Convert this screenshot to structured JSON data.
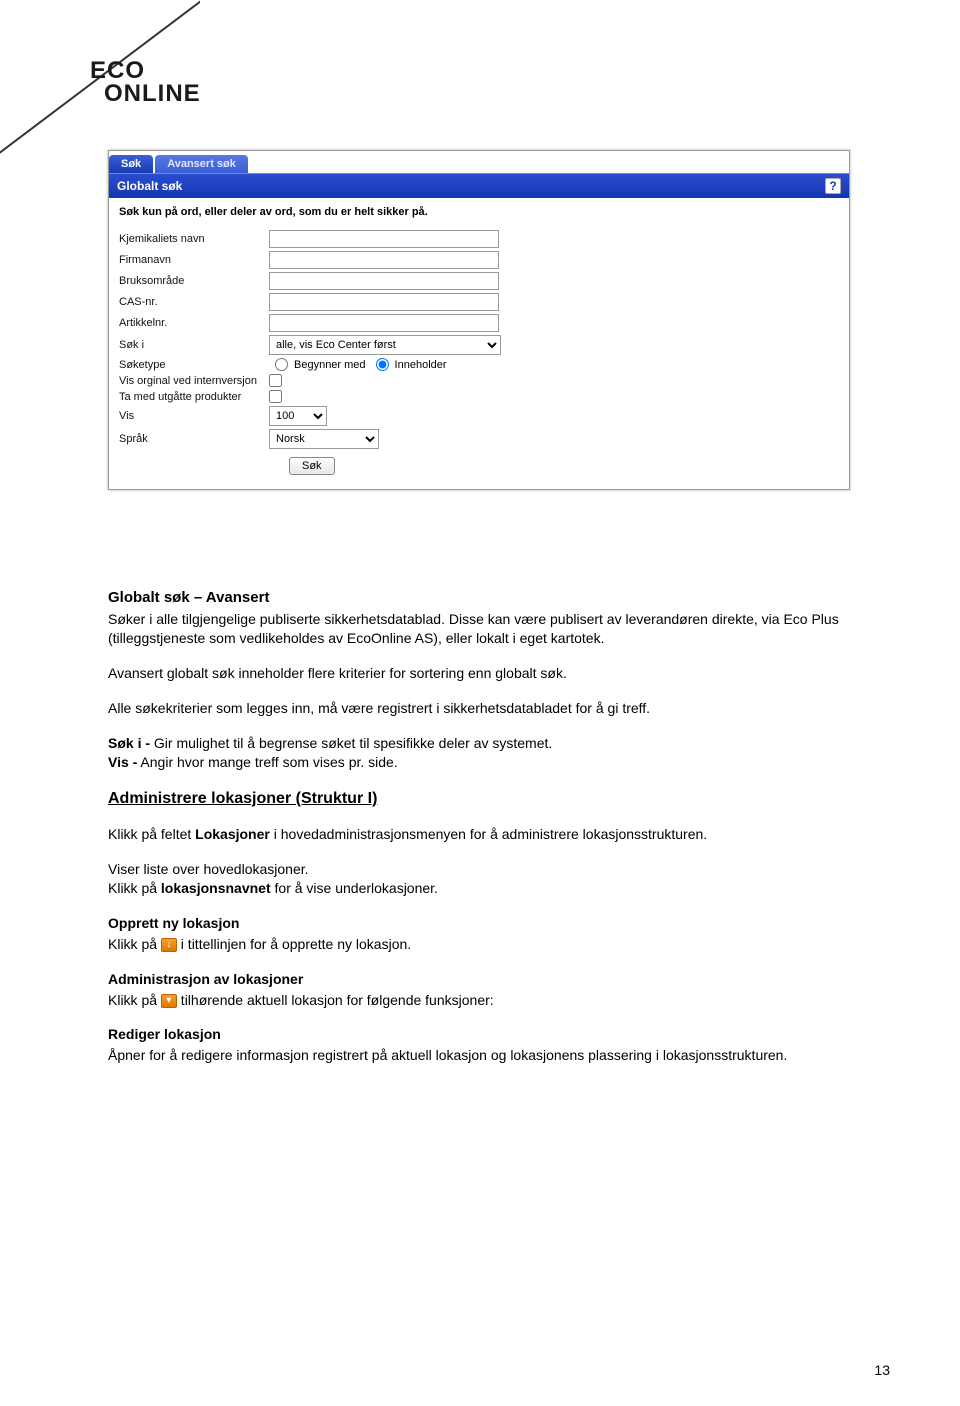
{
  "logo": {
    "line1": "ECO",
    "line2": "ONLINE"
  },
  "screenshot": {
    "tab1": "Søk",
    "tab2": "Avansert søk",
    "header": "Globalt søk",
    "help": "?",
    "instruction": "Søk kun på ord, eller deler av ord, som du er helt sikker på.",
    "labels": {
      "kjemikalietsNavn": "Kjemikaliets navn",
      "firmanavn": "Firmanavn",
      "bruksomrade": "Bruksområde",
      "casNr": "CAS-nr.",
      "artikkelnr": "Artikkelnr.",
      "sokI": "Søk i",
      "soketype": "Søketype",
      "visOriginal": "Vis orginal ved internversjon",
      "taMed": "Ta med utgåtte produkter",
      "vis": "Vis",
      "sprak": "Språk"
    },
    "sokISelected": "alle, vis Eco Center først",
    "radio1": "Begynner med",
    "radio2": "Inneholder",
    "visSelected": "100",
    "sprakSelected": "Norsk",
    "searchBtn": "Søk"
  },
  "doc": {
    "h1": "Globalt søk – Avansert",
    "p1": "Søker i alle tilgjengelige publiserte sikkerhetsdatablad. Disse kan være publisert av leverandøren direkte, via Eco Plus (tilleggstjeneste som vedlikeholdes av EcoOnline AS), eller lokalt i eget kartotek.",
    "p2": "Avansert globalt søk inneholder flere kriterier for sortering enn globalt søk.",
    "p3": "Alle søkekriterier som legges inn, må være registrert i sikkerhetsdatabladet for å gi treff.",
    "p4a_bold": "Søk i -",
    "p4a_rest": " Gir mulighet til å begrense søket til spesifikke deler av systemet.",
    "p4b_bold": "Vis -",
    "p4b_rest": " Angir hvor mange treff som vises pr. side.",
    "h2": "Administrere lokasjoner (Struktur I)",
    "p5a": "Klikk på feltet ",
    "p5bold": "Lokasjoner",
    "p5b": " i hovedadministrasjonsmenyen for å administrere lokasjonsstrukturen.",
    "p6": "Viser liste over hovedlokasjoner.",
    "p7a": "Klikk på ",
    "p7bold": "lokasjonsnavnet",
    "p7b": " for å vise underlokasjoner.",
    "sub1": "Opprett ny lokasjon",
    "p8a": "Klikk på ",
    "p8b": "  i tittellinjen for å opprette ny lokasjon.",
    "sub2": "Administrasjon av lokasjoner",
    "p9a": "Klikk på ",
    "p9b": "  tilhørende aktuell lokasjon for følgende funksjoner:",
    "sub3": "Rediger lokasjon",
    "p10": "Åpner for å redigere informasjon registrert på aktuell lokasjon og lokasjonens plassering i lokasjonsstrukturen."
  },
  "pageNumber": "13"
}
